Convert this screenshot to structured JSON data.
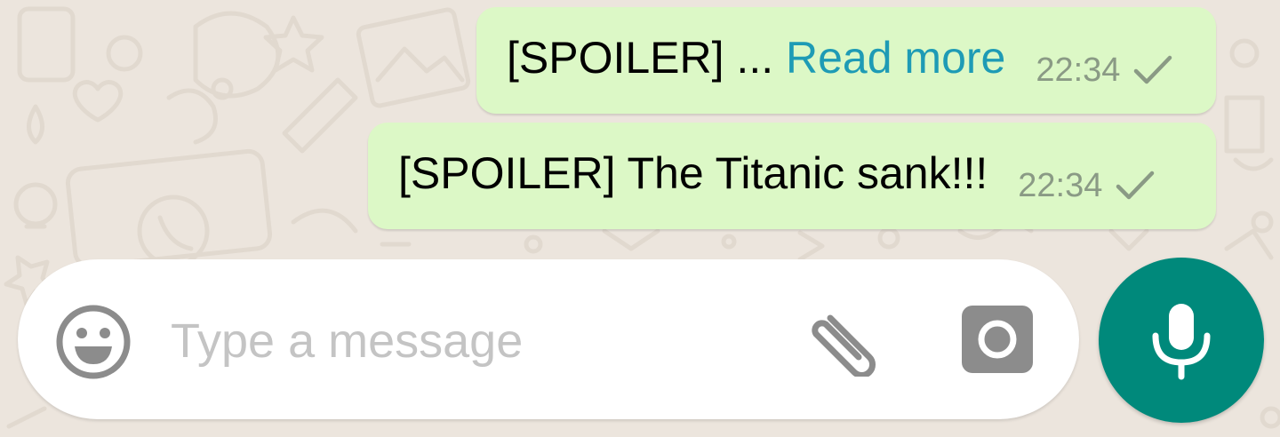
{
  "messages": [
    {
      "text": "[SPOILER] ... ",
      "link_text": "Read more",
      "time": "22:34",
      "status_icon": "single-check-icon"
    },
    {
      "text": "[SPOILER] The Titanic sank!!!",
      "time": "22:34",
      "status_icon": "single-check-icon"
    }
  ],
  "composer": {
    "placeholder": "Type a message",
    "value": "",
    "emoji_icon": "smiley-icon",
    "attach_icon": "paperclip-icon",
    "camera_icon": "camera-icon",
    "send_icon": "microphone-icon"
  },
  "colors": {
    "chat_background": "#ece5dd",
    "outgoing_bubble": "#dcf8c6",
    "link": "#1e9bb5",
    "accent": "#00897b",
    "meta_text": "#8a9a85"
  }
}
